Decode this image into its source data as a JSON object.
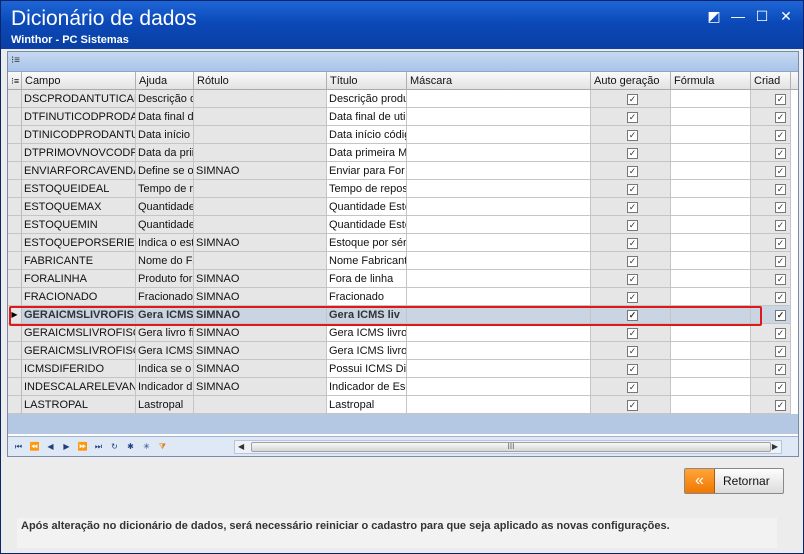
{
  "window": {
    "title": "Dicionário de dados",
    "subtitle": "Winthor - PC Sistemas",
    "controls": [
      "restore",
      "minimize",
      "maximize",
      "close"
    ]
  },
  "grid": {
    "columns": [
      "Campo",
      "Ajuda",
      "Rótulo",
      "Título",
      "Máscara",
      "Auto geração",
      "Fórmula",
      "Criad"
    ],
    "rows": [
      {
        "campo": "DSCPRODANTUTICAD",
        "ajuda": "Descrição d",
        "rotulo": "",
        "titulo": "Descrição produ",
        "auto": true
      },
      {
        "campo": "DTFINUTICODPRODAN",
        "ajuda": "Data final d",
        "rotulo": "",
        "titulo": "Data final de uti",
        "auto": true
      },
      {
        "campo": "DTINICODPRODANTUT",
        "ajuda": "Data início c",
        "rotulo": "",
        "titulo": "Data início códig",
        "auto": true
      },
      {
        "campo": "DTPRIMOVNOVCODPR",
        "ajuda": "Data da prii",
        "rotulo": "",
        "titulo": "Data primeira M",
        "auto": true
      },
      {
        "campo": "ENVIARFORCAVENDAS",
        "ajuda": "Define se o",
        "rotulo": "SIMNAO",
        "titulo": "Enviar para For",
        "auto": true
      },
      {
        "campo": "ESTOQUEIDEAL",
        "ajuda": "Tempo de r",
        "rotulo": "",
        "titulo": "Tempo de repos",
        "auto": true
      },
      {
        "campo": "ESTOQUEMAX",
        "ajuda": "Quantidade",
        "rotulo": "",
        "titulo": "Quantidade Esto",
        "auto": true
      },
      {
        "campo": "ESTOQUEMIN",
        "ajuda": "Quantidade",
        "rotulo": "",
        "titulo": "Quantidade Esto",
        "auto": true
      },
      {
        "campo": "ESTOQUEPORSERIE",
        "ajuda": "Indica o est",
        "rotulo": "SIMNAO",
        "titulo": "Estoque por sér",
        "auto": true
      },
      {
        "campo": "FABRICANTE",
        "ajuda": "Nome do Fa",
        "rotulo": "",
        "titulo": "Nome Fabricant",
        "auto": true
      },
      {
        "campo": "FORALINHA",
        "ajuda": "Produto for",
        "rotulo": "SIMNAO",
        "titulo": "Fora de linha",
        "auto": true
      },
      {
        "campo": "FRACIONADO",
        "ajuda": "Fracionado",
        "rotulo": "SIMNAO",
        "titulo": "Fracionado",
        "auto": true
      },
      {
        "campo": "GERAICMSLIVROFIS",
        "ajuda": "Gera ICMS",
        "rotulo": "SIMNAO",
        "titulo": "Gera ICMS liv",
        "auto": true,
        "selected": true
      },
      {
        "campo": "GERAICMSLIVROFISCA",
        "ajuda": "Gera livro fi",
        "rotulo": "SIMNAO",
        "titulo": "Gera ICMS livro",
        "auto": true
      },
      {
        "campo": "GERAICMSLIVROFISCA",
        "ajuda": "Gera ICMS",
        "rotulo": "SIMNAO",
        "titulo": "Gera ICMS livro",
        "auto": true
      },
      {
        "campo": "ICMSDIFERIDO",
        "ajuda": "Indica se o",
        "rotulo": "SIMNAO",
        "titulo": "Possui ICMS Difi",
        "auto": true
      },
      {
        "campo": "INDESCALARELEVANTE",
        "ajuda": "Indicador d",
        "rotulo": "SIMNAO",
        "titulo": "Indicador de Esc",
        "auto": true
      },
      {
        "campo": "LASTROPAL",
        "ajuda": "Lastropal",
        "rotulo": "",
        "titulo": "Lastropal",
        "auto": true
      }
    ]
  },
  "navigator": [
    "first",
    "prev-page",
    "prev",
    "next",
    "next-page",
    "last",
    "refresh",
    "asterisk",
    "filter-star",
    "filter"
  ],
  "buttons": {
    "retornar": "Retornar"
  },
  "footer": {
    "message": "Após alteração no dicionário de dados, será necessário reiniciar o cadastro para que seja aplicado as novas configurações."
  },
  "colors": {
    "titlebar": "#0b49b8",
    "selection_outline": "#e01818",
    "button_icon": "#f07800"
  }
}
